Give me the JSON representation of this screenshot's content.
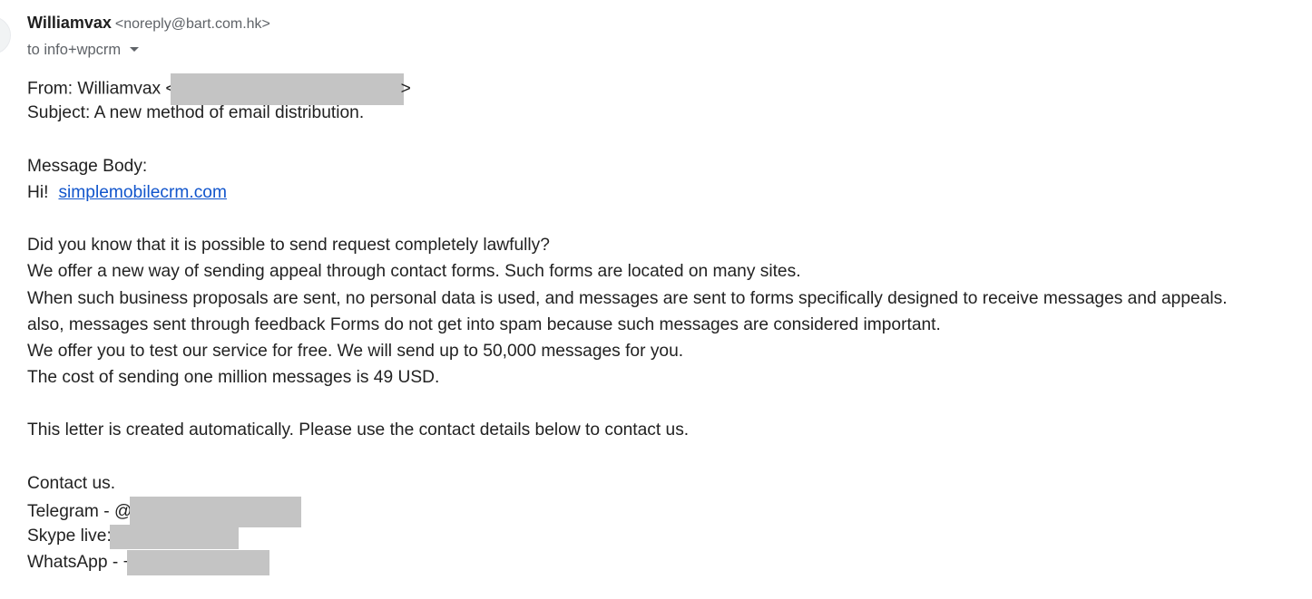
{
  "header": {
    "sender_name": "Williamvax",
    "sender_email": "<noreply@bart.com.hk>",
    "recipient": "to info+wpcrm"
  },
  "message": {
    "from_prefix": "From: Williamvax <",
    "from_suffix": ">",
    "subject": "Subject: A new method of email distribution.",
    "body_heading": "Message Body:",
    "greeting": "Hi!",
    "link": "simplemobilecrm.com",
    "paragraph_lines": [
      "Did you know that it is possible to send request completely lawfully?",
      "We offer a new way of sending appeal through contact forms. Such forms are located on many sites.",
      "When such business proposals are sent, no personal data is used, and messages are sent to forms specifically designed to receive messages and appeals.",
      "also, messages sent through feedback Forms do not get into spam because such messages are considered important.",
      "We offer you to test our service for free. We will send up to 50,000 messages for you.",
      "The cost of sending one million messages is 49 USD."
    ],
    "auto_note": "This letter is created automatically. Please use the contact details below to contact us.",
    "contact_heading": "Contact us.",
    "telegram_prefix": "Telegram - @",
    "skype_prefix": "Skype  live:",
    "whatsapp_prefix": "WhatsApp - +"
  },
  "colors": {
    "link": "#1155cc",
    "redaction": "#c4c4c4",
    "muted_text": "#5f6368"
  },
  "icons": {
    "recipient_details": "caret-down-icon"
  }
}
